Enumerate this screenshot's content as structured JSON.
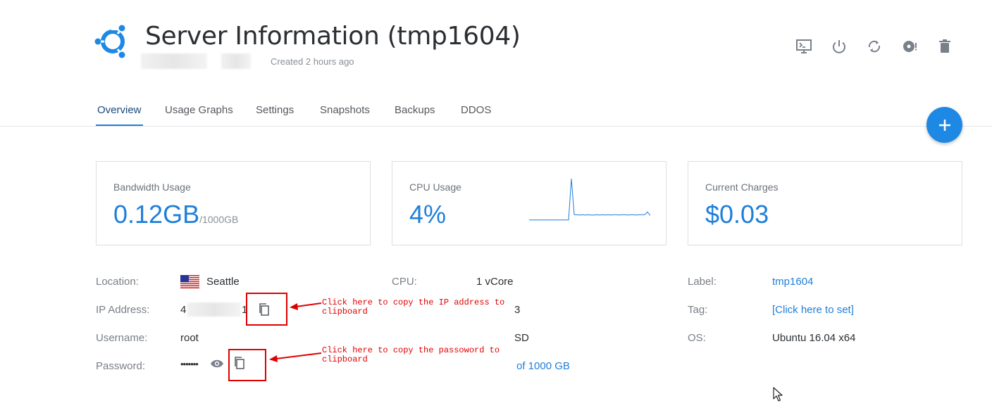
{
  "header": {
    "title": "Server Information (tmp1604)",
    "created": "Created 2 hours ago"
  },
  "toolbar": {
    "buttons": [
      {
        "name": "console-icon"
      },
      {
        "name": "power-icon"
      },
      {
        "name": "restart-icon"
      },
      {
        "name": "reinstall-icon"
      },
      {
        "name": "trash-icon"
      }
    ]
  },
  "tabs": [
    {
      "label": "Overview",
      "active": true
    },
    {
      "label": "Usage Graphs",
      "active": false
    },
    {
      "label": "Settings",
      "active": false
    },
    {
      "label": "Snapshots",
      "active": false
    },
    {
      "label": "Backups",
      "active": false
    },
    {
      "label": "DDOS",
      "active": false
    }
  ],
  "cards": {
    "bandwidth": {
      "title": "Bandwidth Usage",
      "value": "0.12GB",
      "unit": "/1000GB"
    },
    "cpu": {
      "title": "CPU Usage",
      "value": "4%",
      "sparkline": [
        2,
        2,
        2,
        2,
        2,
        2,
        2,
        2,
        2,
        2,
        2,
        2,
        2,
        2,
        2,
        95,
        14,
        14,
        13,
        14,
        13,
        14,
        13,
        13,
        14,
        13,
        14,
        13,
        14,
        13,
        14,
        14,
        13,
        14,
        14,
        13,
        14,
        14,
        13,
        14,
        14,
        14,
        20,
        12
      ]
    },
    "charges": {
      "title": "Current Charges",
      "value": "$0.03"
    }
  },
  "info": {
    "left": {
      "location_label": "Location:",
      "location_value": "Seattle",
      "ip_label": "IP Address:",
      "ip_value_start": "4",
      "ip_value_end": "1",
      "username_label": "Username:",
      "username_value": "root",
      "password_label": "Password:",
      "password_value": "•••••••"
    },
    "middle": {
      "cpu_label": "CPU:",
      "cpu_value": "1 vCore",
      "ram_fragment": "3",
      "storage_fragment": "SD",
      "bandwidth_fragment": "of 1000 GB"
    },
    "right": {
      "label_label": "Label:",
      "label_value": "tmp1604",
      "tag_label": "Tag:",
      "tag_value": "[Click here to set]",
      "os_label": "OS:",
      "os_value": "Ubuntu 16.04 x64"
    }
  },
  "annotations": {
    "ip_note": "Click here to copy the IP address to\nclipboard",
    "password_note": "Click here to copy the passoword to\nclipboard"
  },
  "colors": {
    "accent": "#1e7fd9",
    "fab": "#1e88e5",
    "annotation": "#e00000",
    "logo": "#1e88e5"
  }
}
